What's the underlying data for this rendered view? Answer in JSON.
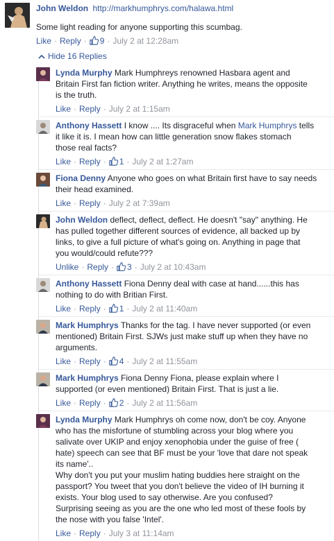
{
  "top_comment": {
    "author": "John Weldon",
    "link": "http://markhumphrys.com/halawa.html",
    "text": "Some light reading for anyone supporting this scumbag.",
    "actions": {
      "like": "Like",
      "reply": "Reply",
      "like_count": "9",
      "time": "July 2 at 12:28am"
    }
  },
  "hide_replies": "Hide 16 Replies",
  "replies": [
    {
      "author": "Lynda Murphy",
      "lines": [
        "Mark Humphreys renowned Hasbara agent and",
        "Britain First fan fiction writer. Anything he writes, means the opposite",
        "is the truth."
      ],
      "like": "Like",
      "reply": "Reply",
      "like_count": "",
      "time": "July 2 at 1:15am"
    },
    {
      "author": "Anthony Hassett",
      "lines_parts": {
        "l1a": "I know .... Its disgraceful when ",
        "l1link": "Mark Humphrys",
        "l1b": " tells",
        "l2": "it like it is. I mean how can little generation snow flakes stomach",
        "l3": "those real facts?"
      },
      "like": "Like",
      "reply": "Reply",
      "like_count": "1",
      "time": "July 2 at 1:27am"
    },
    {
      "author": "Fiona Denny",
      "lines": [
        "Anyone who goes on what Britain first have to say needs",
        "their head examined."
      ],
      "like": "Like",
      "reply": "Reply",
      "like_count": "",
      "time": "July 2 at 7:39am"
    },
    {
      "author": "John Weldon",
      "lines": [
        "deflect, deflect, deflect. He doesn't \"say\" anything. He",
        "has pulled together different sources of evidence, all backed up by",
        "links, to give a full picture of what's going on. Anything in page that",
        "you would/could refute???"
      ],
      "like": "Unlike",
      "reply": "Reply",
      "like_count": "3",
      "time": "July 2 at 10:43am"
    },
    {
      "author": "Anthony Hassett",
      "lines": [
        "Fiona Denny deal with case at hand......this has",
        "nothing to do with Britian First."
      ],
      "like": "Like",
      "reply": "Reply",
      "like_count": "1",
      "time": "July 2 at 11:40am"
    },
    {
      "author": "Mark Humphrys",
      "lines": [
        "Thanks for the tag. I have never supported (or even",
        "mentioned) Britain First. SJWs just make stuff up when they have no",
        "arguments."
      ],
      "like": "Like",
      "reply": "Reply",
      "like_count": "4",
      "time": "July 2 at 11:55am"
    },
    {
      "author": "Mark Humphrys",
      "lines": [
        "Fiona Denny Fiona, please explain where I",
        "supported (or even mentioned) Britain First. That is just a lie."
      ],
      "like": "Like",
      "reply": "Reply",
      "like_count": "2",
      "time": "July 2 at 11:56am"
    },
    {
      "author": "Lynda Murphy",
      "lines": [
        "Mark Humphrys oh come now, don't be coy. Anyone",
        "who has the misfortune of stumbling across your blog where you",
        "salivate over UKIP and enjoy xenophobia under the guise of free (",
        "hate) speech can see that BF must be your 'love that dare not speak",
        "its name'..",
        "Why don't you put your muslim hating buddies here straight on the",
        "passport? You tweet that you don't believe the video of IH burning it",
        "exists. Your blog used to say otherwise. Are you confused?",
        "Surprising seeing as you are the one who led most of these fools by",
        "the nose with you false 'Intel'."
      ],
      "like": "Like",
      "reply": "Reply",
      "like_count": "",
      "time": "July 3 at 11:14am"
    }
  ],
  "colors": {
    "link": "#365899",
    "meta": "#90949c",
    "text": "#1d2129"
  },
  "icons": [
    "thumbs-up-icon",
    "chevron-up-icon"
  ]
}
